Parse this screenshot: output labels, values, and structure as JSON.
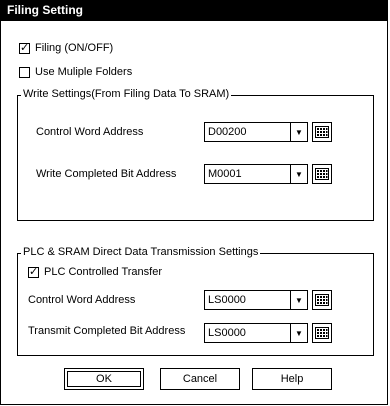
{
  "window": {
    "title": "Filing Setting"
  },
  "filing": {
    "label": "Filing (ON/OFF)",
    "checked": true
  },
  "multiple_folders": {
    "label": "Use Muliple Folders",
    "checked": false
  },
  "write_group": {
    "title": "Write Settings(From Filing Data To SRAM)",
    "control_word_label": "Control Word Address",
    "control_word_value": "D00200",
    "write_completed_label": "Write Completed Bit Address",
    "write_completed_value": "M0001"
  },
  "plc_group": {
    "title": "PLC & SRAM Direct Data Transmission Settings",
    "plc_controlled_label": "PLC Controlled Transfer",
    "plc_controlled_checked": true,
    "control_word_label": "Control Word Address",
    "control_word_value": "LS0000",
    "transmit_completed_label": "Transmit Completed Bit Address",
    "transmit_completed_value": "LS0000"
  },
  "buttons": {
    "ok": "OK",
    "cancel": "Cancel",
    "help": "Help"
  },
  "icons": {
    "dropdown": "chevron-down-icon",
    "keypad": "keypad-icon"
  }
}
